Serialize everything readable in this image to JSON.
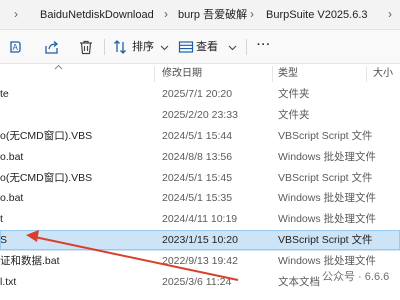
{
  "address": {
    "crumbs": [
      "BaiduNetdiskDownload",
      "burp 吾爱破解",
      "BurpSuite V2025.6.3"
    ],
    "separator": "›"
  },
  "toolbar": {
    "sort_label": "排序",
    "view_label": "查看",
    "more_label": "···"
  },
  "columns": {
    "date_modified": "修改日期",
    "type": "类型",
    "size": "大小"
  },
  "files": [
    {
      "name": "te",
      "date": "2025/7/1 20:20",
      "type": "文件夹",
      "selected": false
    },
    {
      "name": "",
      "date": "2025/2/20 23:33",
      "type": "文件夹",
      "selected": false
    },
    {
      "name": "o(无CMD窗口).VBS",
      "date": "2024/5/1 15:44",
      "type": "VBScript Script 文件",
      "selected": false
    },
    {
      "name": "o.bat",
      "date": "2024/8/8 13:56",
      "type": "Windows 批处理文件",
      "selected": false
    },
    {
      "name": "o(无CMD窗口).VBS",
      "date": "2024/5/1 15:45",
      "type": "VBScript Script 文件",
      "selected": false
    },
    {
      "name": "o.bat",
      "date": "2024/5/1 15:35",
      "type": "Windows 批处理文件",
      "selected": false
    },
    {
      "name": "t",
      "date": "2024/4/11 10:19",
      "type": "Windows 批处理文件",
      "selected": false
    },
    {
      "name": "S",
      "date": "2023/1/15 10:20",
      "type": "VBScript Script 文件",
      "selected": true
    },
    {
      "name": "证和数据.bat",
      "date": "2022/9/13 19:42",
      "type": "Windows 批处理文件",
      "selected": false
    },
    {
      "name": "l.txt",
      "date": "2025/3/6 11:24",
      "type": "文本文档",
      "selected": false
    }
  ],
  "watermark": "公众号 · 6.6.6",
  "colors": {
    "selected_row": "#cde4f7",
    "arrow": "#d9402b",
    "accent": "#0067c0"
  }
}
